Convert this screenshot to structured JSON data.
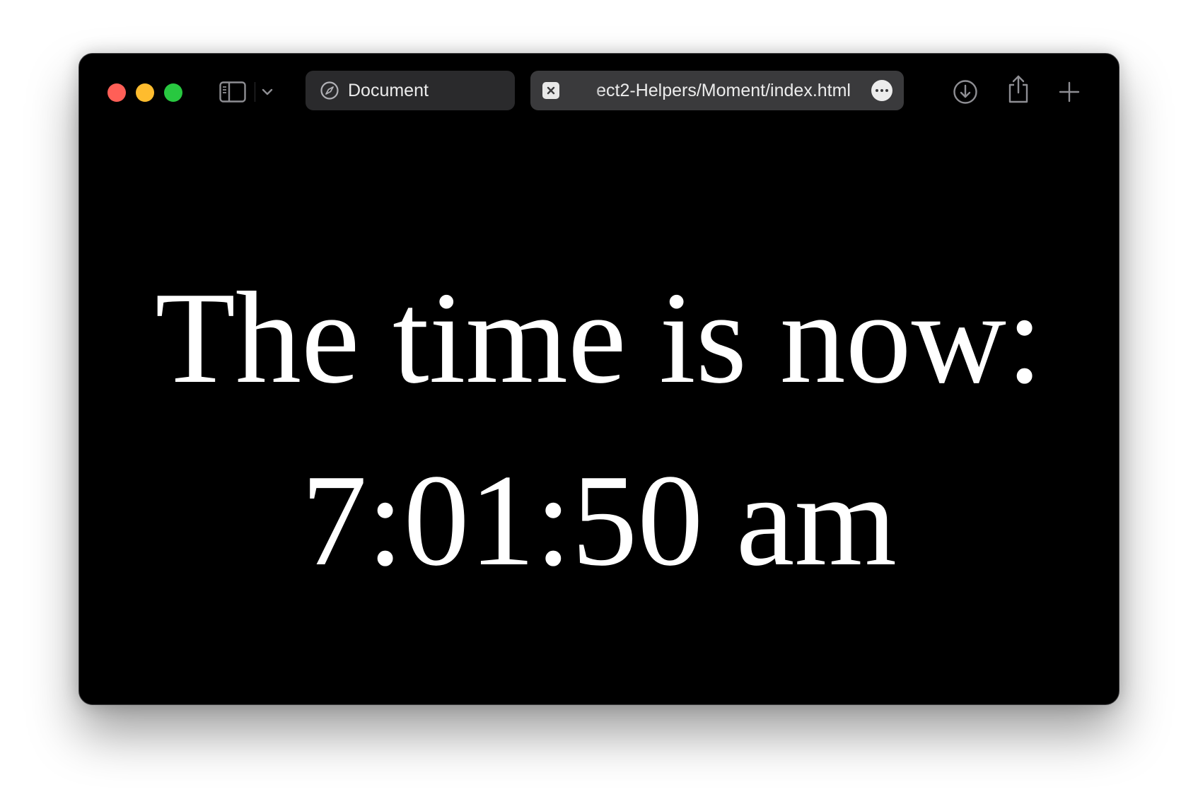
{
  "window": {
    "traffic_lights": {
      "close_color": "#ff5f57",
      "minimize_color": "#febc2e",
      "maximize_color": "#28c840"
    }
  },
  "toolbar": {
    "sidebar_icon": "sidebar-icon",
    "chevron_icon": "chevron-down-icon",
    "tabs": [
      {
        "label": "Document",
        "icon": "compass-icon",
        "active": false
      },
      {
        "label": "ect2-Helpers/Moment/index.html",
        "icon": "close-icon",
        "active": true,
        "more_icon": "ellipsis-icon"
      }
    ],
    "actions": [
      {
        "icon": "download-icon"
      },
      {
        "icon": "share-icon"
      },
      {
        "icon": "plus-icon"
      }
    ]
  },
  "page": {
    "headline": "The time is now:",
    "time": "7:01:50 am",
    "background": "#000000",
    "text_color": "#ffffff"
  }
}
